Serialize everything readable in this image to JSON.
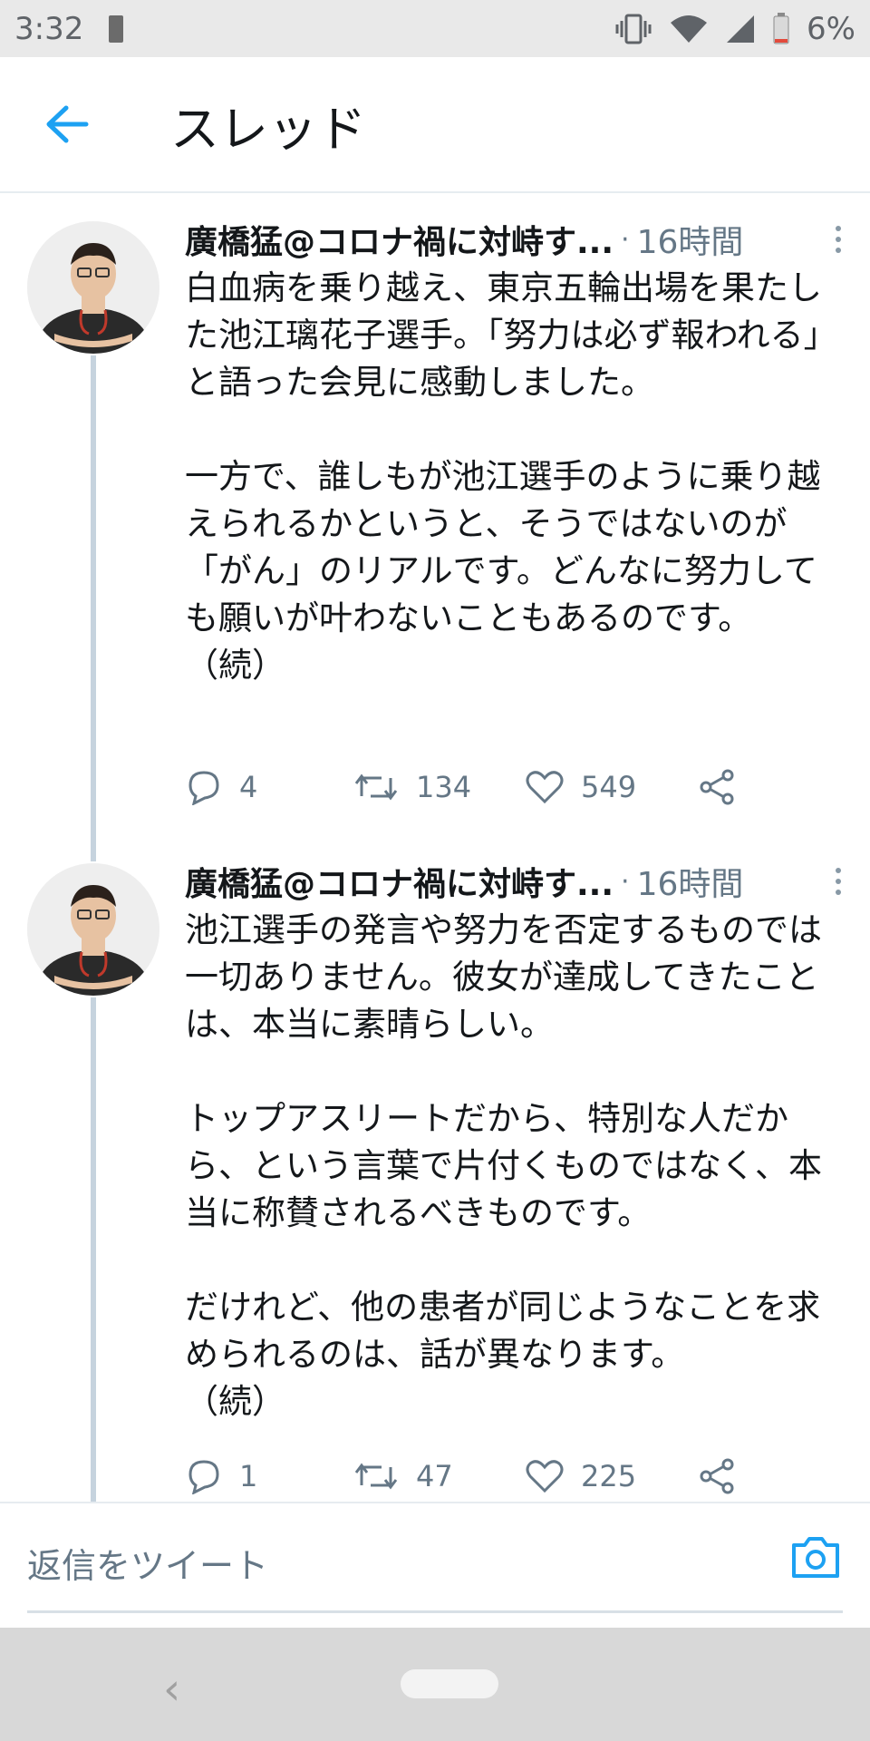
{
  "status_bar": {
    "time": "3:32",
    "battery_percent": "6%"
  },
  "header": {
    "title": "スレッド"
  },
  "tweets": [
    {
      "author": "廣橋猛@コロナ禍に対峙す...",
      "separator": "·",
      "time": "16時間",
      "text": "白血病を乗り越え、東京五輪出場を果たした池江璃花子選手。「努力は必ず報われる」と語った会見に感動しました。\n\n一方で、誰しもが池江選手のように乗り越えられるかというと、そうではないのが「がん」のリアルです。どんなに努力しても願いが叶わないこともあるのです。\n（続）",
      "replies": "4",
      "retweets": "134",
      "likes": "549"
    },
    {
      "author": "廣橋猛@コロナ禍に対峙す...",
      "separator": "·",
      "time": "16時間",
      "text": "池江選手の発言や努力を否定するものでは一切ありません。彼女が達成してきたことは、本当に素晴らしい。\n\nトップアスリートだから、特別な人だから、という言葉で片付くものではなく、本当に称賛されるべきものです。\n\nだけれど、他の患者が同じようなことを求められるのは、話が異なります。\n（続）",
      "replies": "1",
      "retweets": "47",
      "likes": "225"
    }
  ],
  "reply_bar": {
    "placeholder": "返信をツイート"
  },
  "colors": {
    "accent": "#1da1f2",
    "muted": "#657786",
    "thread_line": "#c6d3de"
  }
}
